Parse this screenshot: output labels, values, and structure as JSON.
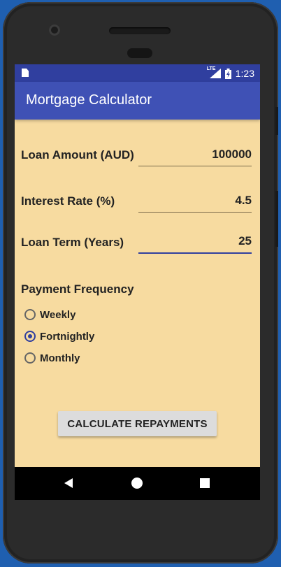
{
  "status_bar": {
    "network_label": "LTE",
    "time": "1:23"
  },
  "app_bar": {
    "title": "Mortgage Calculator"
  },
  "form": {
    "loan_amount": {
      "label": "Loan Amount (AUD)",
      "value": "100000"
    },
    "interest_rate": {
      "label": "Interest Rate (%)",
      "value": "4.5"
    },
    "loan_term": {
      "label": "Loan Term (Years)",
      "value": "25"
    }
  },
  "payment_frequency": {
    "heading": "Payment Frequency",
    "options": [
      {
        "label": "Weekly",
        "checked": false
      },
      {
        "label": "Fortnightly",
        "checked": true
      },
      {
        "label": "Monthly",
        "checked": false
      }
    ]
  },
  "calculate_button": {
    "label": "CALCULATE REPAYMENTS"
  },
  "colors": {
    "background": "#f7dba0",
    "app_bar": "#3f51b5",
    "status_bar": "#303f9f",
    "accent": "#303f9f"
  },
  "icons": {
    "status_left": "sim-card-icon",
    "status_signal": "signal-icon",
    "status_battery": "battery-charging-icon",
    "nav_back": "back-icon",
    "nav_home": "home-icon",
    "nav_recent": "recent-apps-icon"
  }
}
